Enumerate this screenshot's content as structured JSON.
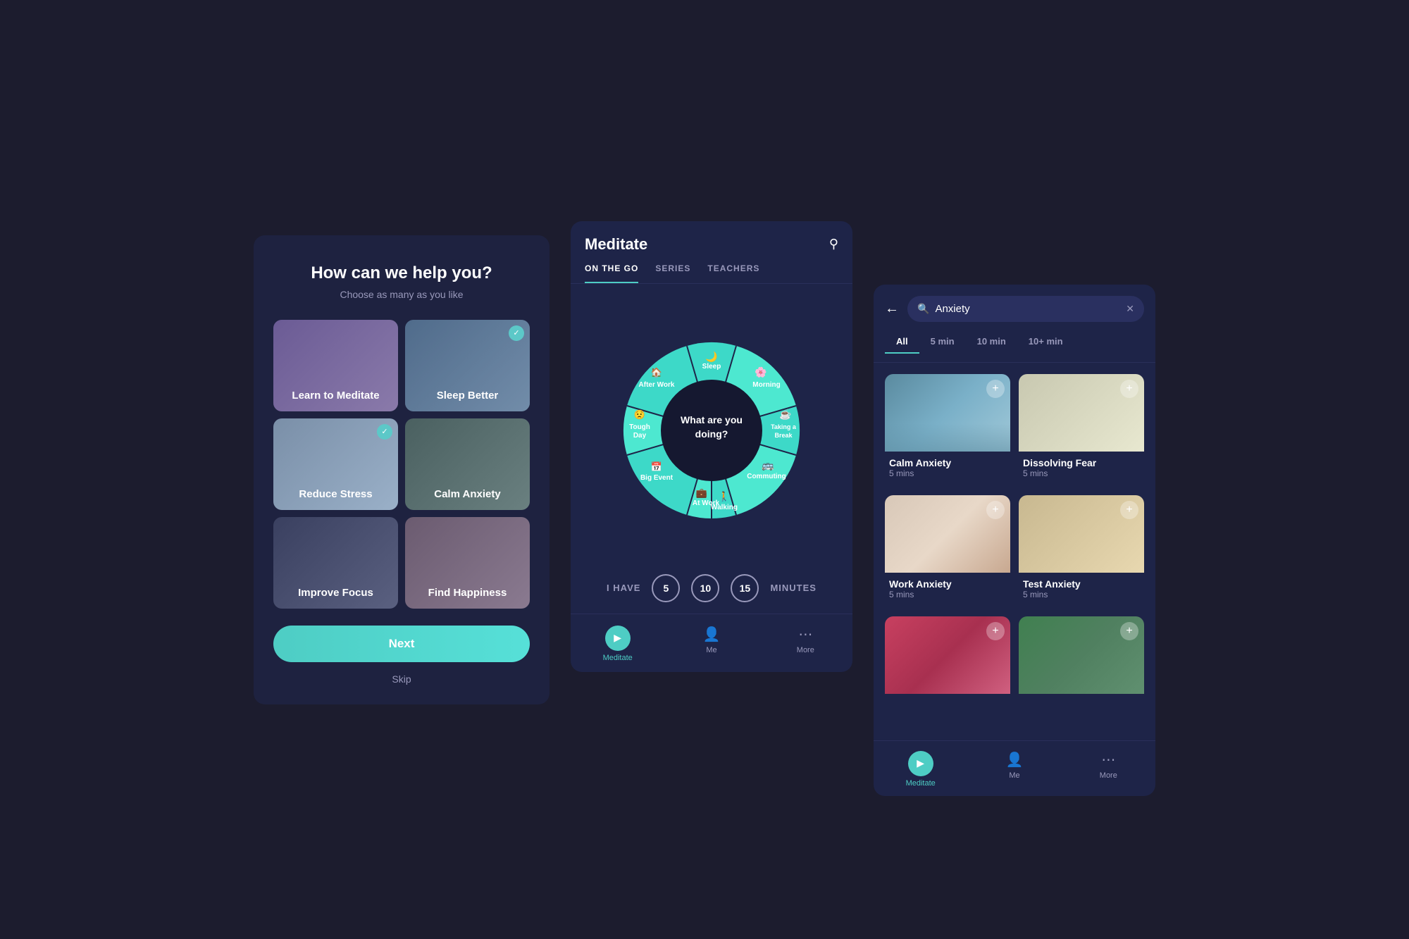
{
  "background": {
    "color": "#1a1a2e"
  },
  "screen1": {
    "title": "How can we help you?",
    "subtitle": "Choose as many as you like",
    "options": [
      {
        "id": "learn",
        "label": "Learn to Meditate",
        "checked": false,
        "style": "learn"
      },
      {
        "id": "sleep",
        "label": "Sleep Better",
        "checked": true,
        "style": "sleep"
      },
      {
        "id": "reduce",
        "label": "Reduce Stress",
        "checked": true,
        "style": "reduce"
      },
      {
        "id": "calm",
        "label": "Calm Anxiety",
        "checked": false,
        "style": "calm"
      },
      {
        "id": "focus",
        "label": "Improve Focus",
        "checked": false,
        "style": "focus"
      },
      {
        "id": "happiness",
        "label": "Find Happiness",
        "checked": false,
        "style": "happiness"
      }
    ],
    "next_button": "Next",
    "skip_label": "Skip"
  },
  "screen2": {
    "title": "Meditate",
    "tabs": [
      {
        "id": "on-the-go",
        "label": "ON THE GO",
        "active": true
      },
      {
        "id": "series",
        "label": "SERIES",
        "active": false
      },
      {
        "id": "teachers",
        "label": "TEACHERS",
        "active": false
      }
    ],
    "wheel": {
      "center_text": "What are you doing?",
      "segments": [
        {
          "id": "sleep",
          "label": "Sleep",
          "icon": "🌙"
        },
        {
          "id": "morning",
          "label": "Morning",
          "icon": "🌸"
        },
        {
          "id": "after-work",
          "label": "After Work",
          "icon": "🏠"
        },
        {
          "id": "taking-break",
          "label": "Taking a Break",
          "icon": "☕"
        },
        {
          "id": "tough-day",
          "label": "Tough Day",
          "icon": "😟"
        },
        {
          "id": "commuting",
          "label": "Commuting",
          "icon": "🚌"
        },
        {
          "id": "big-event",
          "label": "Big Event",
          "icon": "📅"
        },
        {
          "id": "walking",
          "label": "Walking",
          "icon": "🚶"
        },
        {
          "id": "at-work",
          "label": "At Work",
          "icon": "💼"
        }
      ]
    },
    "minutes": {
      "prefix": "I HAVE",
      "options": [
        "5",
        "10",
        "15"
      ],
      "suffix": "MINUTES"
    },
    "nav": [
      {
        "id": "meditate",
        "label": "Meditate",
        "active": true,
        "icon": "play"
      },
      {
        "id": "me",
        "label": "Me",
        "active": false,
        "icon": "person"
      },
      {
        "id": "more",
        "label": "More",
        "active": false,
        "icon": "dots"
      }
    ]
  },
  "screen3": {
    "search": {
      "placeholder": "Anxiety",
      "value": "Anxiety"
    },
    "filter_tabs": [
      {
        "id": "all",
        "label": "All",
        "active": true
      },
      {
        "id": "5min",
        "label": "5 min",
        "active": false
      },
      {
        "id": "10min",
        "label": "10 min",
        "active": false
      },
      {
        "id": "10plus",
        "label": "10+ min",
        "active": false
      }
    ],
    "results": [
      {
        "id": "calm-anxiety",
        "title": "Calm Anxiety",
        "duration": "5 mins",
        "img": "calm"
      },
      {
        "id": "dissolving-fear",
        "title": "Dissolving Fear",
        "duration": "5 mins",
        "img": "dissolving"
      },
      {
        "id": "work-anxiety",
        "title": "Work Anxiety",
        "duration": "5 mins",
        "img": "work"
      },
      {
        "id": "test-anxiety",
        "title": "Test Anxiety",
        "duration": "5 mins",
        "img": "test"
      },
      {
        "id": "result-5",
        "title": "",
        "duration": "",
        "img": "bottom-left"
      },
      {
        "id": "result-6",
        "title": "",
        "duration": "",
        "img": "bottom-right"
      }
    ],
    "nav": [
      {
        "id": "meditate",
        "label": "Meditate",
        "active": true,
        "icon": "play"
      },
      {
        "id": "me",
        "label": "Me",
        "active": false,
        "icon": "person"
      },
      {
        "id": "more",
        "label": "More",
        "active": false,
        "icon": "dots"
      }
    ]
  }
}
